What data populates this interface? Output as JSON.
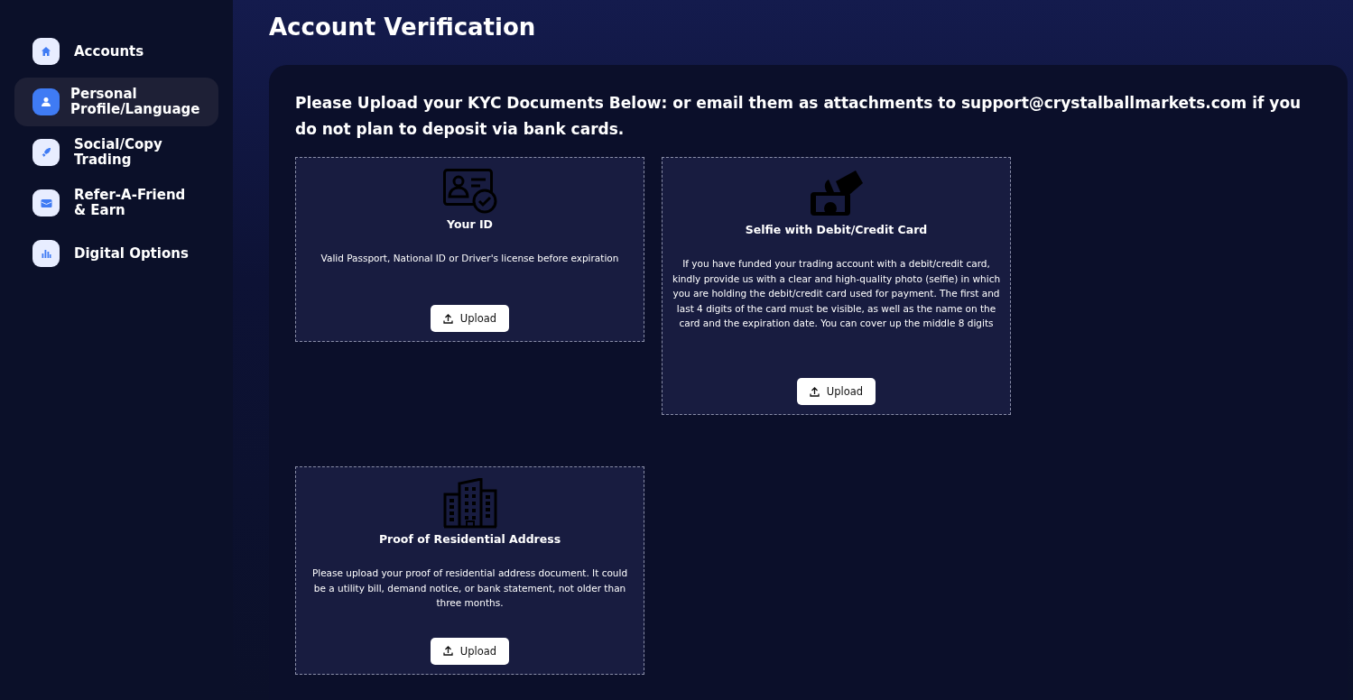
{
  "sidebar": {
    "items": [
      {
        "label": "Accounts",
        "kind": "home",
        "selected": false
      },
      {
        "label": "Personal Profile/Language",
        "kind": "profile",
        "selected": true
      },
      {
        "label": "Social/Copy Trading",
        "kind": "social",
        "selected": false
      },
      {
        "label": "Refer-A-Friend & Earn",
        "kind": "referral",
        "selected": false
      },
      {
        "label": "Digital Options",
        "kind": "options",
        "selected": false
      }
    ]
  },
  "page": {
    "title": "Account Verification",
    "intro": "Please Upload your KYC Documents Below: or email them as attachments to support@crystalballmarkets.com if you do not plan to deposit via bank cards.",
    "documents": [
      {
        "kind": "id",
        "title": "Your ID",
        "description": "Valid Passport, National ID or Driver's license before expiration",
        "button": "Upload"
      },
      {
        "kind": "selfie",
        "title": "Selfie with Debit/Credit Card",
        "description": "If you have funded your trading account with a debit/credit card, kindly provide us with a clear and high-quality photo (selfie) in which you are holding the debit/credit card used for payment. The first and last 4 digits of the card must be visible, as well as the name on the card and the expiration date. You can cover up the middle 8 digits",
        "button": "Upload"
      },
      {
        "kind": "building",
        "title": "Proof of Residential Address",
        "description": "Please upload your proof of residential address document. It could be a utility bill, demand notice, or bank statement, not older than three months.",
        "button": "Upload"
      }
    ]
  }
}
